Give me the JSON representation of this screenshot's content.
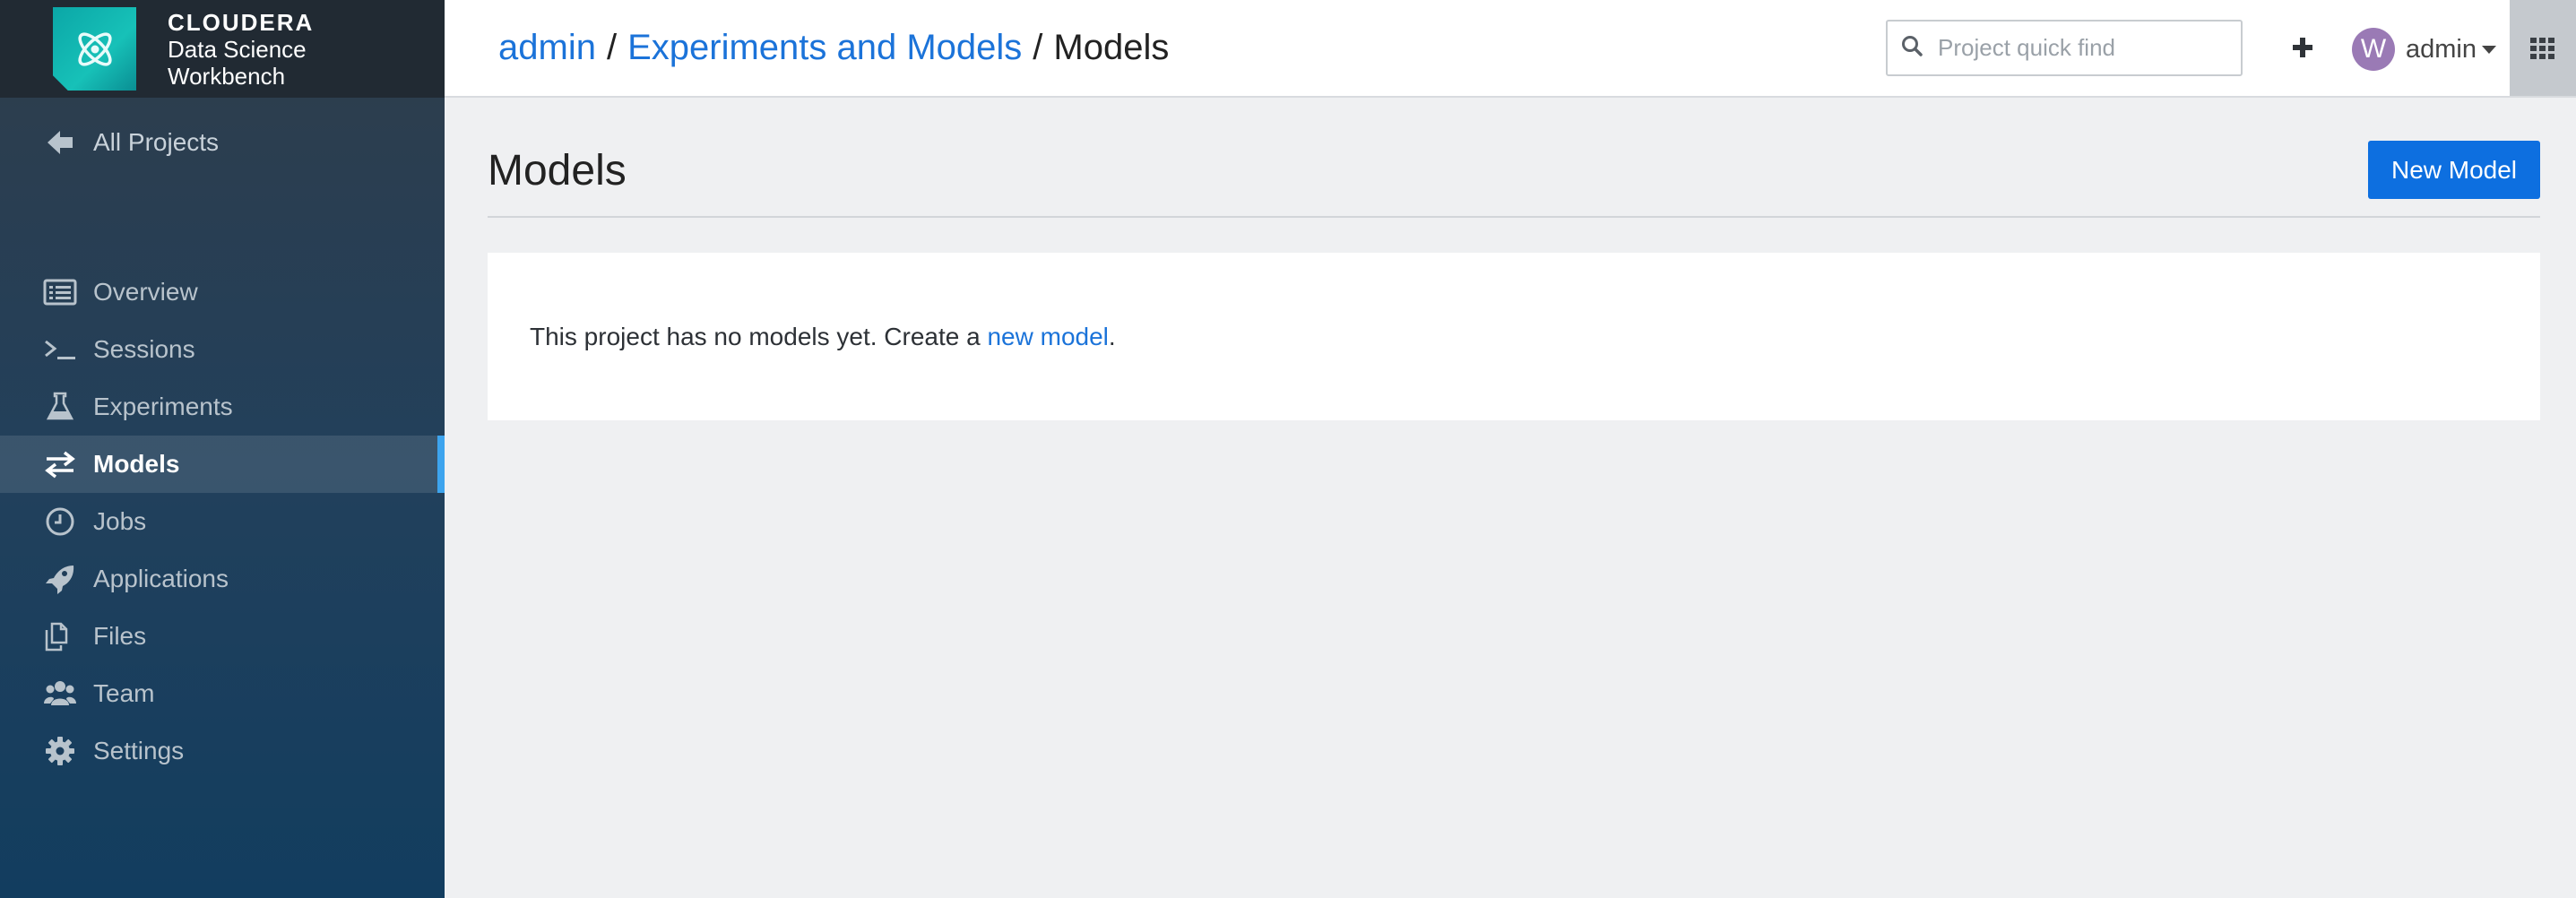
{
  "brand": {
    "company": "CLOUDERA",
    "product_line1": "Data Science",
    "product_line2": "Workbench",
    "icon": "cloudera-logo-icon",
    "color": "#12b5b0"
  },
  "sidebar": {
    "back": {
      "label": "All Projects",
      "icon": "arrow-left-icon"
    },
    "items": [
      {
        "label": "Overview",
        "icon": "list-icon",
        "active": false
      },
      {
        "label": "Sessions",
        "icon": "terminal-icon",
        "active": false
      },
      {
        "label": "Experiments",
        "icon": "flask-icon",
        "active": false
      },
      {
        "label": "Models",
        "icon": "exchange-arrows-icon",
        "active": true
      },
      {
        "label": "Jobs",
        "icon": "clock-icon",
        "active": false
      },
      {
        "label": "Applications",
        "icon": "rocket-icon",
        "active": false
      },
      {
        "label": "Files",
        "icon": "files-icon",
        "active": false
      },
      {
        "label": "Team",
        "icon": "users-icon",
        "active": false
      },
      {
        "label": "Settings",
        "icon": "gear-icon",
        "active": false
      }
    ]
  },
  "header": {
    "breadcrumb": {
      "user": "admin",
      "project": "Experiments and Models",
      "current": "Models",
      "separator": "/"
    },
    "search": {
      "placeholder": "Project quick find",
      "value": ""
    },
    "user": {
      "avatar_letter": "W",
      "name": "admin"
    }
  },
  "main": {
    "title": "Models",
    "new_button": "New Model",
    "empty_text": "This project has no models yet. Create a",
    "empty_link": "new model",
    "empty_suffix": "."
  },
  "colors": {
    "accent": "#0d6fe0",
    "link": "#1b73d9",
    "active_indicator": "#3da4ee",
    "avatar": "#9a7ab5"
  }
}
